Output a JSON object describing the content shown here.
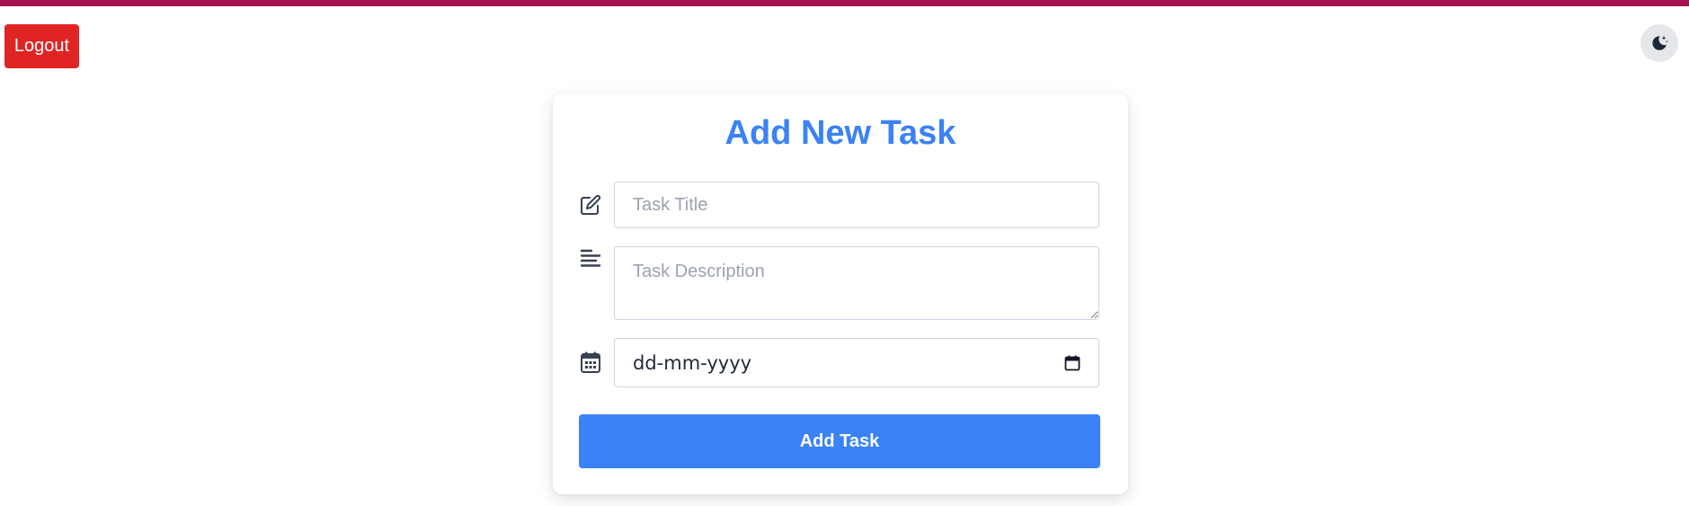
{
  "colors": {
    "top_bar": "#a3144f",
    "logout": "#e02424",
    "accent": "#3b82f6",
    "icon": "#374151"
  },
  "header": {
    "logout_label": "Logout",
    "theme_toggle_icon": "moon-stars-icon"
  },
  "form": {
    "title": "Add New Task",
    "title_input": {
      "icon": "edit-icon",
      "placeholder": "Task Title",
      "value": ""
    },
    "description_input": {
      "icon": "align-left-icon",
      "placeholder": "Task Description",
      "value": ""
    },
    "date_input": {
      "icon": "calendar-icon",
      "placeholder": "dd-mm-yyyy",
      "picker_icon": "calendar-picker-icon"
    },
    "submit_label": "Add Task"
  }
}
